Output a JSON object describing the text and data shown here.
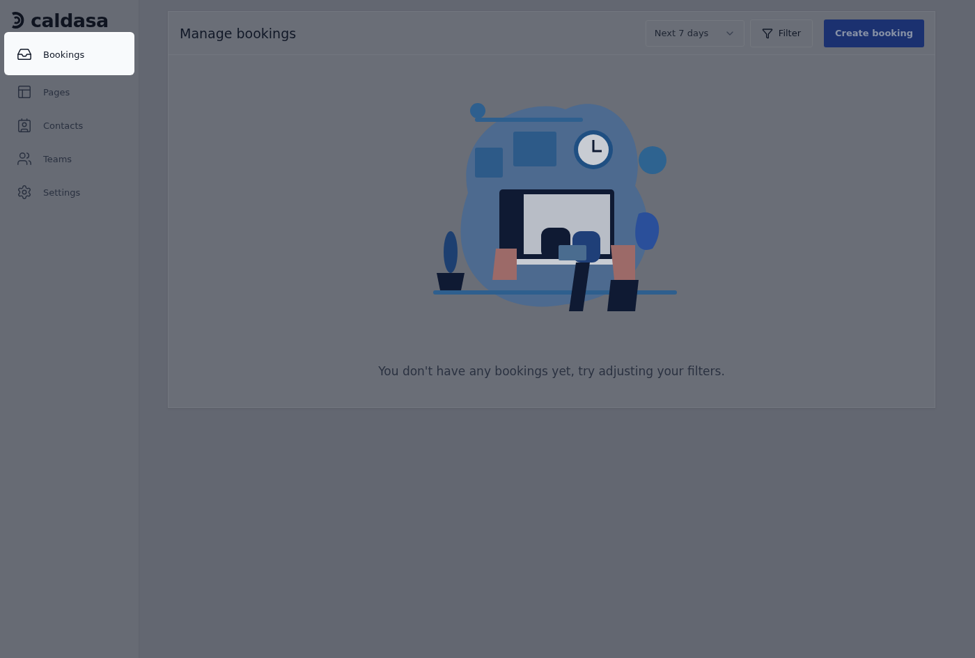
{
  "logo": {
    "text": "caldasa"
  },
  "sidebar": {
    "items": [
      {
        "label": "Bookings",
        "selected": true
      },
      {
        "label": "Pages",
        "selected": false
      },
      {
        "label": "Contacts",
        "selected": false
      },
      {
        "label": "Teams",
        "selected": false
      },
      {
        "label": "Settings",
        "selected": false
      }
    ]
  },
  "header": {
    "title": "Manage bookings",
    "range_select": {
      "value": "Next 7 days"
    },
    "filter_button": "Filter",
    "create_button": "Create booking"
  },
  "empty_state": {
    "message": "You don't have any bookings yet, try adjusting your filters."
  }
}
